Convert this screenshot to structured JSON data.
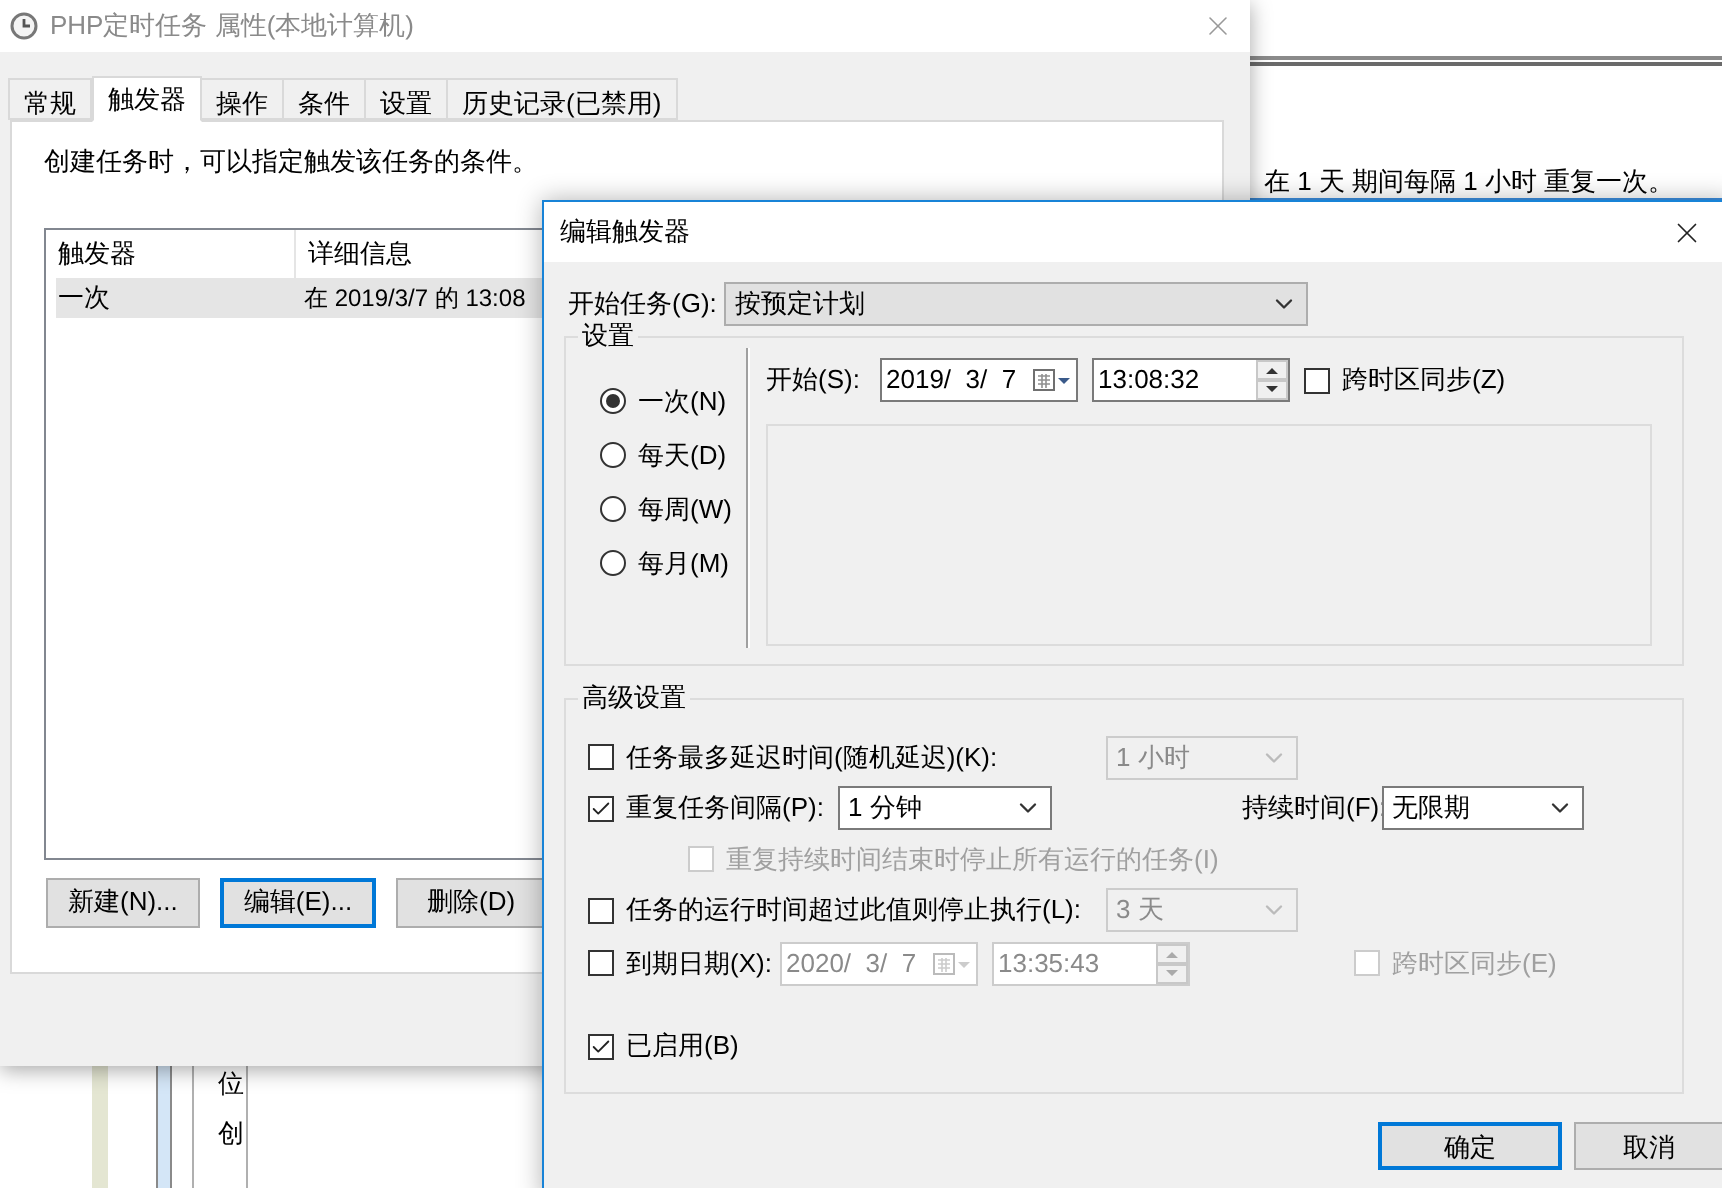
{
  "background_window": {
    "summary": "在 1 天 期间每隔 1 小时 重复一次。",
    "left_items": [
      "位",
      "创"
    ]
  },
  "properties_window": {
    "title": "PHP定时任务 属性(本地计算机)",
    "tabs": [
      {
        "label": "常规",
        "selected": false
      },
      {
        "label": "触发器",
        "selected": true
      },
      {
        "label": "操作",
        "selected": false
      },
      {
        "label": "条件",
        "selected": false
      },
      {
        "label": "设置",
        "selected": false
      },
      {
        "label": "历史记录(已禁用)",
        "selected": false
      }
    ],
    "description": "创建任务时，可以指定触发该任务的条件。",
    "trigger_list": {
      "columns": [
        "触发器",
        "详细信息"
      ],
      "rows": [
        {
          "cells": [
            "一次",
            "在 2019/3/7 的 13:08"
          ],
          "selected": true
        }
      ]
    },
    "buttons": [
      {
        "label": "新建(N)...",
        "focused": false
      },
      {
        "label": "编辑(E)...",
        "focused": true
      },
      {
        "label": "删除(D)",
        "focused": false
      }
    ]
  },
  "edit_trigger_dialog": {
    "title": "编辑触发器",
    "begin_task": {
      "label": "开始任务(G):",
      "value": "按预定计划"
    },
    "settings": {
      "title": "设置",
      "schedules": [
        {
          "label": "一次(N)",
          "selected": true
        },
        {
          "label": "每天(D)",
          "selected": false
        },
        {
          "label": "每周(W)",
          "selected": false
        },
        {
          "label": "每月(M)",
          "selected": false
        }
      ],
      "start": {
        "label": "开始(S):",
        "date": "2019/  3/  7",
        "time": "13:08:32"
      },
      "sync_time_zones": {
        "label": "跨时区同步(Z)",
        "checked": false
      }
    },
    "advanced": {
      "title": "高级设置",
      "delay": {
        "label": "任务最多延迟时间(随机延迟)(K):",
        "checked": false,
        "value": "1 小时",
        "disabled": true
      },
      "repeat": {
        "label": "重复任务间隔(P):",
        "checked": true,
        "value": "1 分钟",
        "duration_label": "持续时间(F):",
        "duration_value": "无限期"
      },
      "stop_at_end": {
        "label": "重复持续时间结束时停止所有运行的任务(I)",
        "checked": false,
        "disabled": true
      },
      "stop_if_longer": {
        "label": "任务的运行时间超过此值则停止执行(L):",
        "checked": false,
        "value": "3 天",
        "disabled": true
      },
      "expire": {
        "label": "到期日期(X):",
        "checked": false,
        "date": "2020/  3/  7",
        "time": "13:35:43",
        "disabled": true,
        "sync_label": "跨时区同步(E)",
        "sync_checked": false
      },
      "enabled": {
        "label": "已启用(B)",
        "checked": true
      }
    },
    "buttons": [
      {
        "label": "确定",
        "default": true
      },
      {
        "label": "取消",
        "default": false
      }
    ]
  }
}
